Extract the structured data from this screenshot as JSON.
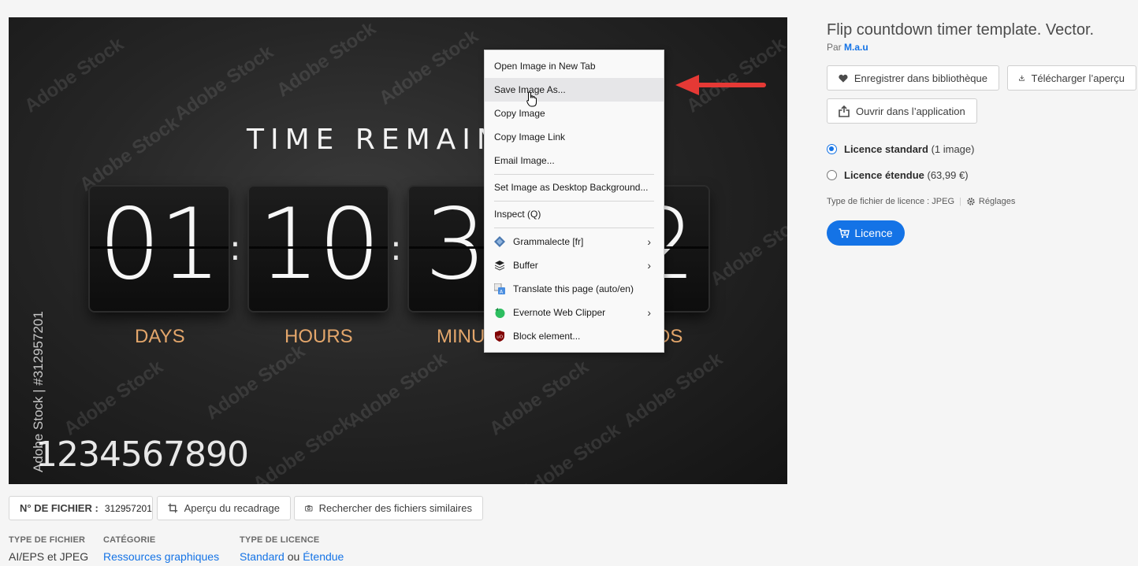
{
  "image": {
    "title_text": "TIME REMAIN",
    "counters": [
      {
        "value": "01",
        "unit": "DAYS"
      },
      {
        "value": "10",
        "unit": "HOURS"
      },
      {
        "value": "3",
        "unit": "MINU"
      },
      {
        "value": "2",
        "unit": "DS"
      }
    ],
    "separator": ":",
    "digits_strip": "1234567890",
    "watermark": "Adobe Stock",
    "side_watermark": "Adobe Stock | #312957201"
  },
  "context_menu": {
    "items": [
      {
        "label": "Open Image in New Tab"
      },
      {
        "label": "Save Image As..."
      },
      {
        "label": "Copy Image"
      },
      {
        "label": "Copy Image Link"
      },
      {
        "label": "Email Image..."
      },
      {
        "label": "Set Image as Desktop Background..."
      },
      {
        "label": "Inspect (Q)"
      },
      {
        "label": "Grammalecte [fr]"
      },
      {
        "label": "Buffer"
      },
      {
        "label": "Translate this page (auto/en)"
      },
      {
        "label": "Evernote Web Clipper"
      },
      {
        "label": "Block element..."
      }
    ],
    "submenu_arrow": "›"
  },
  "asset": {
    "title": "Flip countdown timer template. Vector.",
    "by_prefix": "Par",
    "author": "M.a.u"
  },
  "actions": {
    "save_library": "Enregistrer dans bibliothèque",
    "download_preview": "Télécharger l’aperçu",
    "open_in_app": "Ouvrir dans l’application"
  },
  "licenses": {
    "standard_name": "Licence standard",
    "standard_detail": "(1 image)",
    "extended_name": "Licence étendue",
    "extended_detail": "(63,99 €)",
    "file_type_label": "Type de fichier de licence : JPEG",
    "settings_label": "Réglages",
    "license_button": "Licence"
  },
  "file_info": {
    "file_no_label": "N° DE FICHIER :",
    "file_no": "312957201",
    "crop_preview": "Aperçu du recadrage",
    "find_similar": "Rechercher des fichiers similaires"
  },
  "meta": {
    "file_type_head": "TYPE DE FICHIER",
    "file_type_value": "AI/EPS et JPEG",
    "category_head": "CATÉGORIE",
    "category_value": "Ressources graphiques",
    "license_type_head": "TYPE DE LICENCE",
    "license_standard": "Standard",
    "license_or": "ou",
    "license_extended": "Étendue"
  },
  "colors": {
    "accent": "#1473e6",
    "unit_label": "#e3a66b",
    "arrow": "#e53935"
  }
}
